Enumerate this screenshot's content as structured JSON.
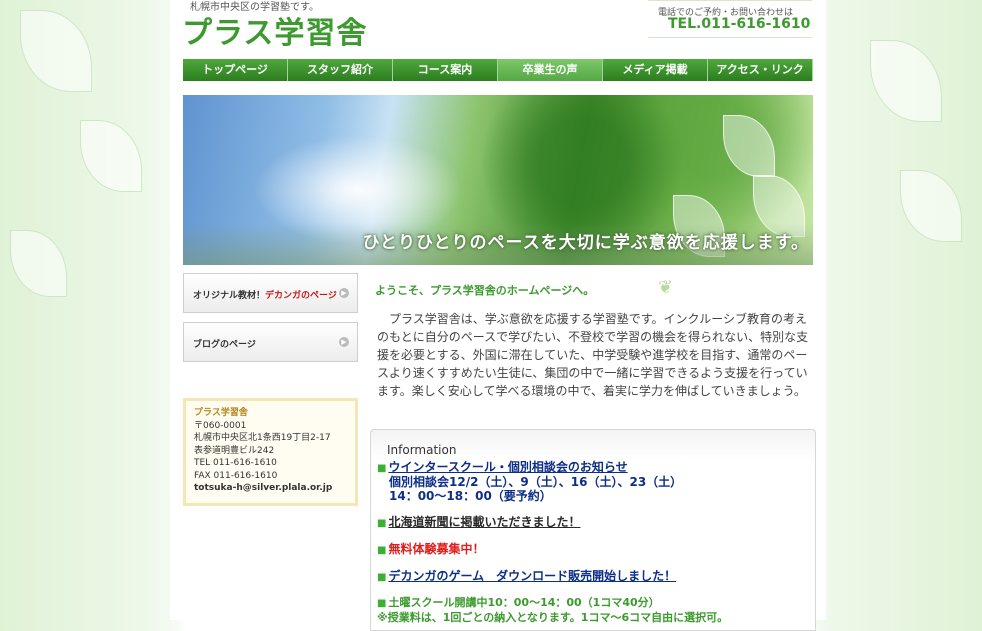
{
  "header": {
    "tagline": "札幌市中央区の学習塾です。",
    "logo": "プラス学習舎",
    "contact_label": "電話でのご予約・お問い合わせは",
    "tel": "TEL.011-616-1610"
  },
  "nav": {
    "items": [
      {
        "label": "トップページ"
      },
      {
        "label": "スタッフ紹介"
      },
      {
        "label": "コース案内"
      },
      {
        "label": "卒業生の声"
      },
      {
        "label": "メディア掲載"
      },
      {
        "label": "アクセス・リンク"
      }
    ]
  },
  "hero": {
    "slogan": "ひとりひとりのペースを大切に学ぶ意欲を応援します。"
  },
  "sidebar": {
    "btn1_prefix": "オリジナル教材！",
    "btn1_highlight": "デカンガのページ",
    "btn2_label": "ブログのページ",
    "address": {
      "name": "プラス学習舎",
      "postal": "〒060-0001",
      "line1": "札幌市中央区北1条西19丁目2-17",
      "line2": "表参道明豊ビル242",
      "tel": "TEL 011-616-1610",
      "fax": "FAX 011-616-1610",
      "email": "totsuka-h@silver.plala.or.jp"
    }
  },
  "main": {
    "welcome": "ようこそ、プラス学習舎のホームページへ。",
    "intro": "　プラス学習舎は、学ぶ意欲を応援する学習塾です。インクルーシブ教育の考えのもとに自分のペースで学びたい、不登校で学習の機会を得られない、特別な支援を必要とする、外国に滞在していた、中学受験や進学校を目指す、通常のペースより速くすすめたい生徒に、集団の中で一緒に学習できるよう支援を行っています。楽しく安心して学べる環境の中で、着実に学力を伸ばしていきましょう。"
  },
  "info": {
    "title": "Information",
    "item1_title": "ウインタースクール・個別相談会のお知らせ",
    "item1_sub1": "個別相談会12/2（土）、9（土）、16（土）、23（土）",
    "item1_sub2": "14：00～18：00（要予約）",
    "item2": "北海道新聞に掲載いただきました！",
    "item3": "無料体験募集中！",
    "item4": "デカンガのゲーム　ダウンロード販売開始しました！",
    "item5": "土曜スクール開講中10：00～14：00（1コマ40分）",
    "item5_note": "※授業料は、1回ごとの納入となります。1コマ～6コマ自由に選択可。"
  },
  "colors": {
    "brand_green": "#3d9a2f",
    "navy_link": "#0c2e86",
    "alert_red": "#e31c1c"
  }
}
